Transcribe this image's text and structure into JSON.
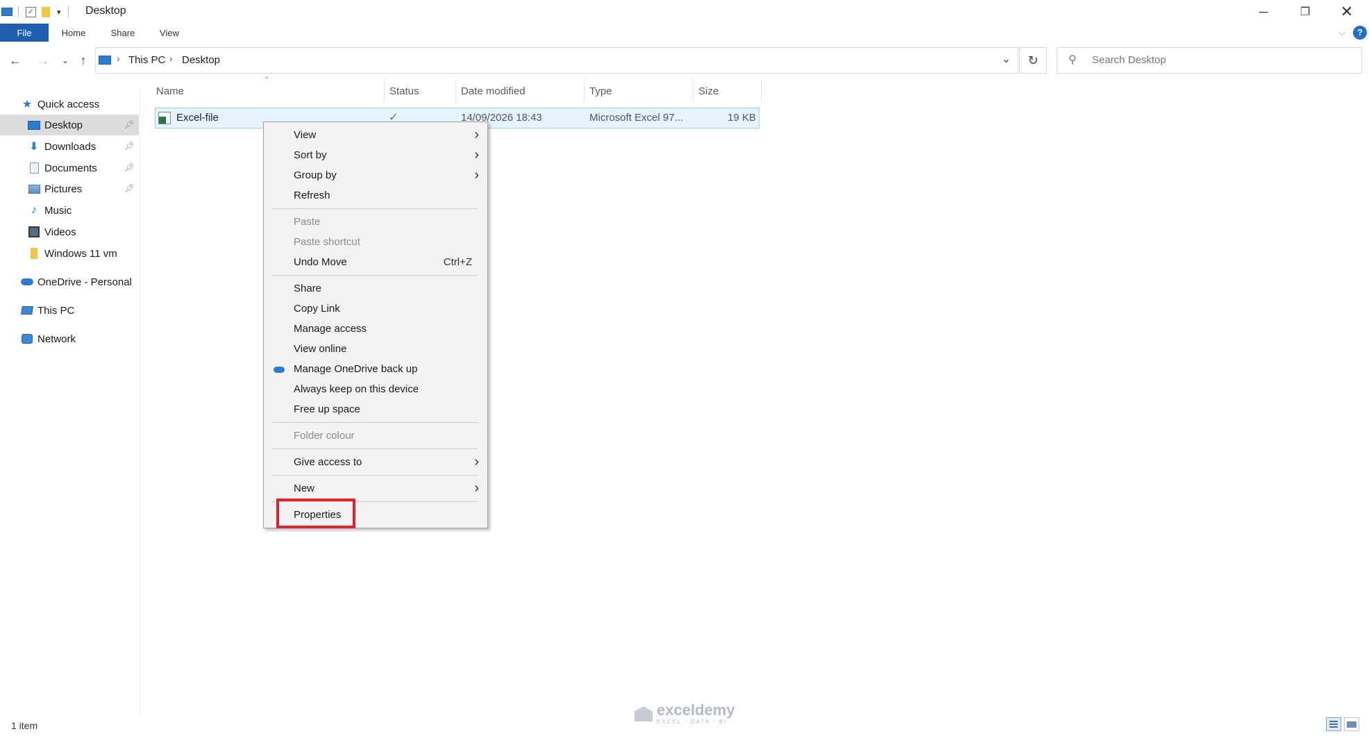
{
  "window": {
    "title": "Desktop",
    "accent_color": "#1f5fb0"
  },
  "ribbon": {
    "tabs": [
      "File",
      "Home",
      "Share",
      "View"
    ]
  },
  "address": {
    "segments": [
      "This PC",
      "Desktop"
    ],
    "search_placeholder": "Search Desktop"
  },
  "sidebar": {
    "quick_access": "Quick access",
    "items": [
      {
        "label": "Desktop",
        "icon": "desktop-icon",
        "pinned": true,
        "selected": true
      },
      {
        "label": "Downloads",
        "icon": "downloads-icon",
        "pinned": true
      },
      {
        "label": "Documents",
        "icon": "documents-icon",
        "pinned": true
      },
      {
        "label": "Pictures",
        "icon": "pictures-icon",
        "pinned": true
      },
      {
        "label": "Music",
        "icon": "music-icon",
        "pinned": false
      },
      {
        "label": "Videos",
        "icon": "videos-icon",
        "pinned": false
      },
      {
        "label": "Windows 11 vm",
        "icon": "folder-icon",
        "pinned": false
      }
    ],
    "onedrive": "OneDrive - Personal",
    "this_pc": "This PC",
    "network": "Network"
  },
  "columns": {
    "name": "Name",
    "status": "Status",
    "date_modified": "Date modified",
    "type": "Type",
    "size": "Size"
  },
  "files": [
    {
      "name": "Excel-file",
      "status_icon": "synced-check-icon",
      "date_modified": "14/09/2026 18:43",
      "type": "Microsoft Excel 97...",
      "size": "19 KB"
    }
  ],
  "context_menu": {
    "view": "View",
    "sort_by": "Sort by",
    "group_by": "Group by",
    "refresh": "Refresh",
    "paste": "Paste",
    "paste_shortcut": "Paste shortcut",
    "undo_move": "Undo Move",
    "undo_move_shortcut": "Ctrl+Z",
    "share": "Share",
    "copy_link": "Copy Link",
    "manage_access": "Manage access",
    "view_online": "View online",
    "manage_onedrive_backup": "Manage OneDrive back up",
    "always_keep": "Always keep on this device",
    "free_up_space": "Free up space",
    "folder_colour": "Folder colour",
    "give_access_to": "Give access to",
    "new": "New",
    "properties": "Properties",
    "highlight_color": "#e0232a"
  },
  "status_bar": {
    "item_count": "1 item"
  },
  "watermark": {
    "brand": "exceldemy",
    "tagline": "EXCEL · DATA · BI"
  }
}
